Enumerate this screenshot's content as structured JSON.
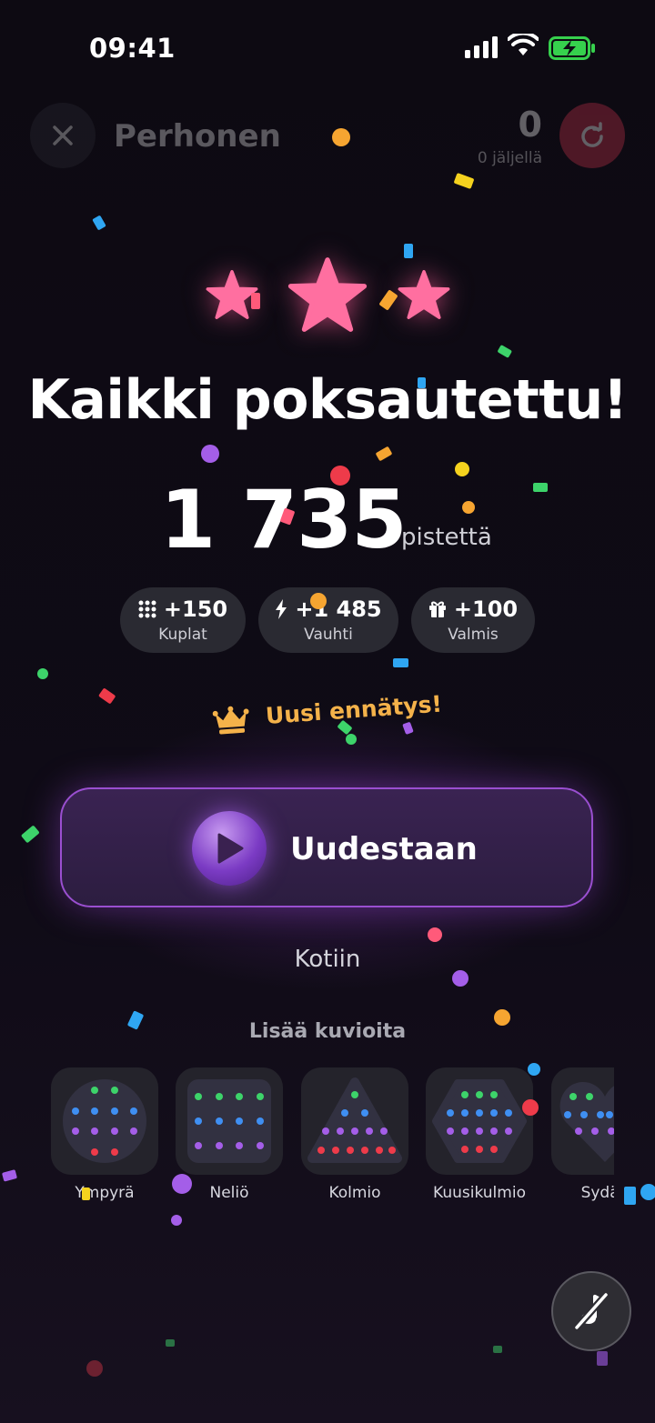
{
  "status_bar": {
    "time": "09:41"
  },
  "header": {
    "title": "Perhonen",
    "remaining_count": "0",
    "remaining_label": "0 jäljellä"
  },
  "result": {
    "stars_earned": 3,
    "headline": "Kaikki poksautettu!",
    "score": "1 735",
    "score_unit": "pistettä",
    "breakdown": [
      {
        "icon": "bubbles-grid-icon",
        "value": "+150",
        "label": "Kuplat"
      },
      {
        "icon": "lightning-icon",
        "value": "+1 485",
        "label": "Vauhti"
      },
      {
        "icon": "gift-icon",
        "value": "+100",
        "label": "Valmis"
      }
    ],
    "record": "Uusi ennätys!"
  },
  "actions": {
    "again": "Uudestaan",
    "home": "Kotiin"
  },
  "more_patterns": {
    "title": "Lisää kuvioita",
    "items": [
      {
        "label": "Ympyrä"
      },
      {
        "label": "Neliö"
      },
      {
        "label": "Kolmio"
      },
      {
        "label": "Kuusikulmio"
      },
      {
        "label": "Sydän"
      }
    ]
  },
  "colors": {
    "accent": "#9a4fd0",
    "star": "#ff6fa0",
    "record": "#f4b24a",
    "reset": "#c8324a"
  }
}
